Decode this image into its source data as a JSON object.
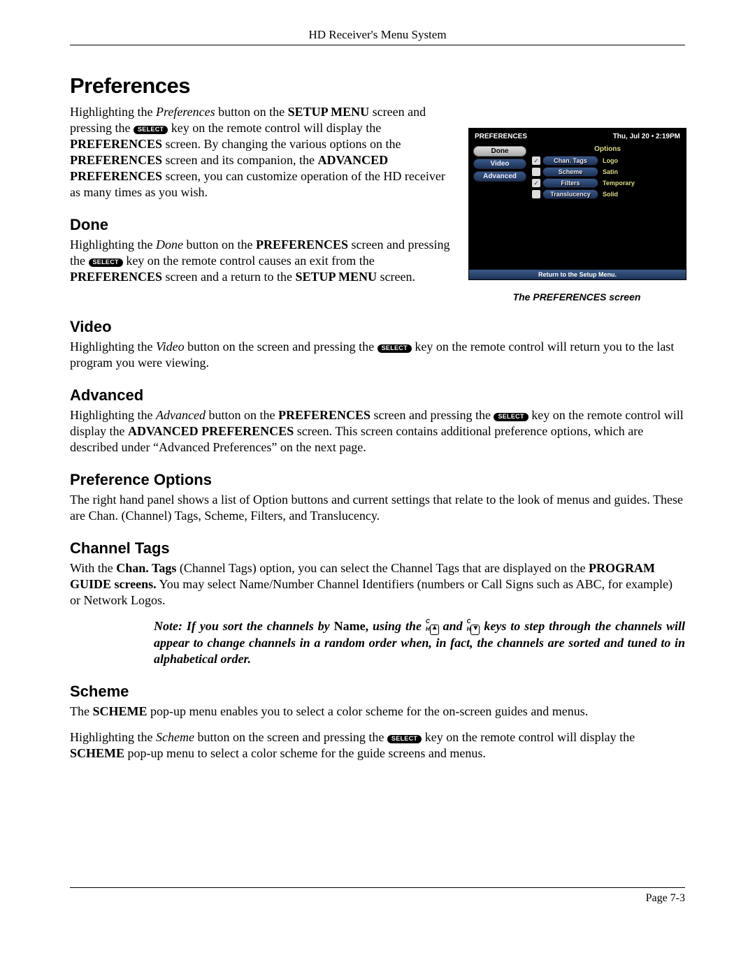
{
  "header": "HD Receiver's Menu System",
  "title": "Preferences",
  "select_key_label": "SELECT",
  "intro": {
    "p1a": "Highlighting the ",
    "p1b": "Preferences",
    "p1c": " button on the ",
    "p1d": "SETUP MENU",
    "p1e": " screen and pressing the ",
    "p1f": " key on the remote control will display the ",
    "p1g": "PREFERENCES",
    "p1h": " screen. By changing the various options on the ",
    "p1i": "PREFERENCES",
    "p1j": " screen and its companion, the ",
    "p1k": "ADVANCED PREFERENCES",
    "p1l": " screen, you can customize operation of the HD receiver as many times as you wish."
  },
  "screenshot": {
    "title_left": "PREFERENCES",
    "title_right": "Thu, Jul 20 • 2:19PM",
    "left_buttons": [
      "Done",
      "Video",
      "Advanced"
    ],
    "options_title": "Options",
    "rows": [
      {
        "check": "✓",
        "label": "Chan. Tags",
        "value": "Logo"
      },
      {
        "check": "",
        "label": "Scheme",
        "value": "Satin"
      },
      {
        "check": "✓",
        "label": "Filters",
        "value": "Temporary"
      },
      {
        "check": "",
        "label": "Translucency",
        "value": "Solid"
      }
    ],
    "footer": "Return to the Setup Menu.",
    "caption": "The PREFERENCES screen"
  },
  "done": {
    "h": "Done",
    "a": "Highlighting the ",
    "b": "Done",
    "c": " button on the ",
    "d": "PREFERENCES",
    "e": " screen and pressing the ",
    "f": " key on the remote control causes an exit from the ",
    "g": "PREFERENCES",
    "h2": " screen and a return to the ",
    "i": "SETUP MENU",
    "j": " screen."
  },
  "video": {
    "h": "Video",
    "a": "Highlighting the ",
    "b": "Video",
    "c": " button on the screen and pressing the ",
    "d": " key on the remote control will return you to the last program you were viewing."
  },
  "advanced": {
    "h": "Advanced",
    "a": "Highlighting the ",
    "b": "Advanced",
    "c": " button on the ",
    "d": "PREFERENCES",
    "e": " screen and pressing the ",
    "f": " key on the remote control will display the ",
    "g": "ADVANCED PREFERENCES",
    "h2": " screen. This screen contains additional preference options, which are described under “Advanced Preferences” on the next page."
  },
  "pref_opts": {
    "h": "Preference Options",
    "p": "The right hand panel shows a list of Option buttons and current settings that relate to the look of menus and guides. These are Chan. (Channel) Tags, Scheme, Filters, and Translucency."
  },
  "chtags": {
    "h": "Channel Tags",
    "a": "With the ",
    "b": "Chan. Tags",
    "c": " (Channel Tags) option, you can select the Channel Tags that are displayed on the ",
    "d": "PROGRAM GUIDE screens.",
    "e": " You may select Name/Number Channel Identifiers (numbers or Call Signs such as ABC, for example) or Network Logos."
  },
  "note": {
    "a": "Note: If you sort the channels by ",
    "b": "Name,",
    "c": " using the ",
    "d": " and ",
    "e": " keys to step through the channels will appear to change channels in a random order when, in fact, the channels are sorted and tuned to in alphabetical order."
  },
  "scheme": {
    "h": "Scheme",
    "p1a": "The ",
    "p1b": "SCHEME",
    "p1c": " pop-up menu enables you to select a color scheme for the on-screen guides and menus.",
    "p2a": "Highlighting the ",
    "p2b": "Scheme",
    "p2c": " button on the screen and pressing the ",
    "p2d": " key on the remote control will display the ",
    "p2e": "SCHEME",
    "p2f": " pop-up menu to select a color scheme for the guide screens and menus."
  },
  "footer": "Page 7-3"
}
